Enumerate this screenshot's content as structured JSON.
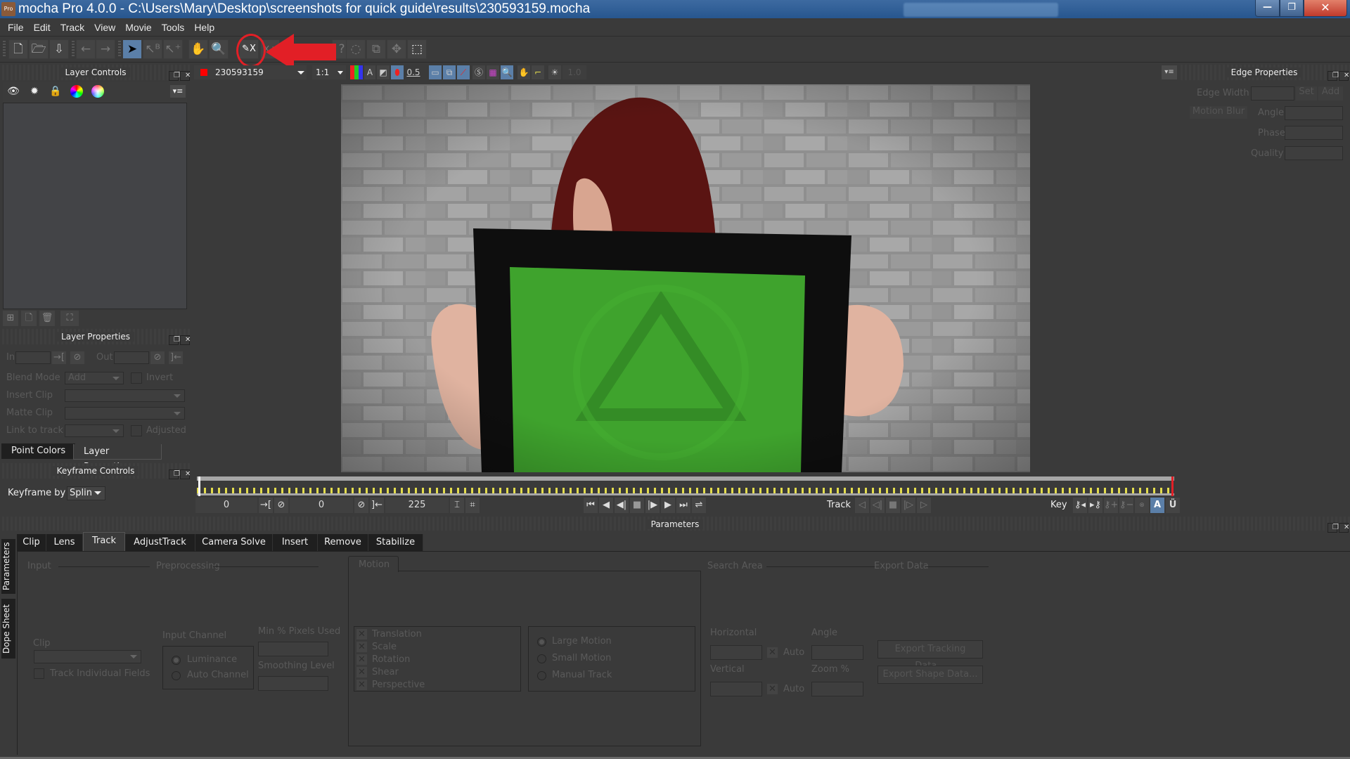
{
  "window": {
    "title": "mocha Pro 4.0.0 - C:\\Users\\Mary\\Desktop\\screenshots for quick guide\\results\\230593159.mocha",
    "app_icon_label": "Pro",
    "controls": {
      "minimize": "—",
      "maximize": "❐",
      "close": "✕"
    }
  },
  "menu": [
    "File",
    "Edit",
    "Track",
    "View",
    "Movie",
    "Tools",
    "Help"
  ],
  "toolbar": {
    "icons": [
      "new-project",
      "open-project",
      "save-project",
      "undo",
      "redo",
      "select",
      "select-bezier",
      "add-point",
      "pan",
      "zoom",
      "create-x-spline",
      "add-x-spline",
      "create-bezier",
      "create-bezier-add",
      "magnetic",
      "rotate-spline",
      "scale",
      "move",
      "select-region"
    ],
    "highlighted": "create-x-spline",
    "annotation_color": "#e21f26"
  },
  "layer_controls": {
    "title": "Layer Controls",
    "header_icons": [
      "visibility-eye",
      "cog",
      "lock",
      "color-wheel",
      "spectrum"
    ]
  },
  "layer_properties": {
    "title": "Layer Properties",
    "in_label": "In",
    "out_label": "Out",
    "blend_mode_label": "Blend Mode",
    "blend_mode_value": "Add",
    "invert_label": "Invert",
    "insert_clip_label": "Insert Clip",
    "matte_clip_label": "Matte Clip",
    "link_to_track_label": "Link to track",
    "adjusted_label": "Adjusted"
  },
  "left_tabs": [
    "Point Colors",
    "Layer Properties"
  ],
  "keyframe_controls": {
    "title": "Keyframe Controls",
    "keyframe_by_label": "Keyframe by",
    "keyframe_by_value": "Splin"
  },
  "viewer": {
    "clip_name": "230593159",
    "clip_color": "#ff0000",
    "zoom": "1:1",
    "alpha_label": "A",
    "overlay_opacity": "0.5",
    "exposure": "1.0"
  },
  "timeline": {
    "in_frame": "0",
    "current_frame": "0",
    "out_frame": "225",
    "track_label": "Track",
    "key_label": "Key"
  },
  "edge_properties": {
    "title": "Edge Properties",
    "edge_width_label": "Edge Width",
    "set_label": "Set",
    "add_label": "Add",
    "motion_blur_label": "Motion Blur",
    "angle_label": "Angle",
    "phase_label": "Phase",
    "quality_label": "Quality"
  },
  "parameters": {
    "title": "Parameters",
    "side_tabs": [
      "Parameters",
      "Dope Sheet"
    ],
    "tabs": [
      "Clip",
      "Lens",
      "Track",
      "AdjustTrack",
      "Camera Solve",
      "Insert",
      "Remove",
      "Stabilize"
    ],
    "active_tab": "Track",
    "input": {
      "title": "Input",
      "clip_label": "Clip",
      "track_individual_fields": "Track Individual Fields"
    },
    "preprocessing": {
      "title": "Preprocessing",
      "input_channel_label": "Input Channel",
      "channels": [
        "Luminance",
        "Auto Channel"
      ],
      "selected_channel": "Luminance",
      "min_pixels_label": "Min % Pixels Used",
      "smoothing_label": "Smoothing Level"
    },
    "motion": {
      "title": "Motion",
      "types": [
        "Translation",
        "Scale",
        "Rotation",
        "Shear",
        "Perspective"
      ],
      "modes": [
        "Large Motion",
        "Small Motion",
        "Manual Track"
      ],
      "selected_mode": "Large Motion"
    },
    "search_area": {
      "title": "Search Area",
      "horizontal_label": "Horizontal",
      "vertical_label": "Vertical",
      "auto_label": "Auto",
      "angle_label": "Angle",
      "zoom_label": "Zoom %"
    },
    "export_data": {
      "title": "Export Data",
      "export_tracking": "Export Tracking Data...",
      "export_shape": "Export Shape Data..."
    }
  }
}
